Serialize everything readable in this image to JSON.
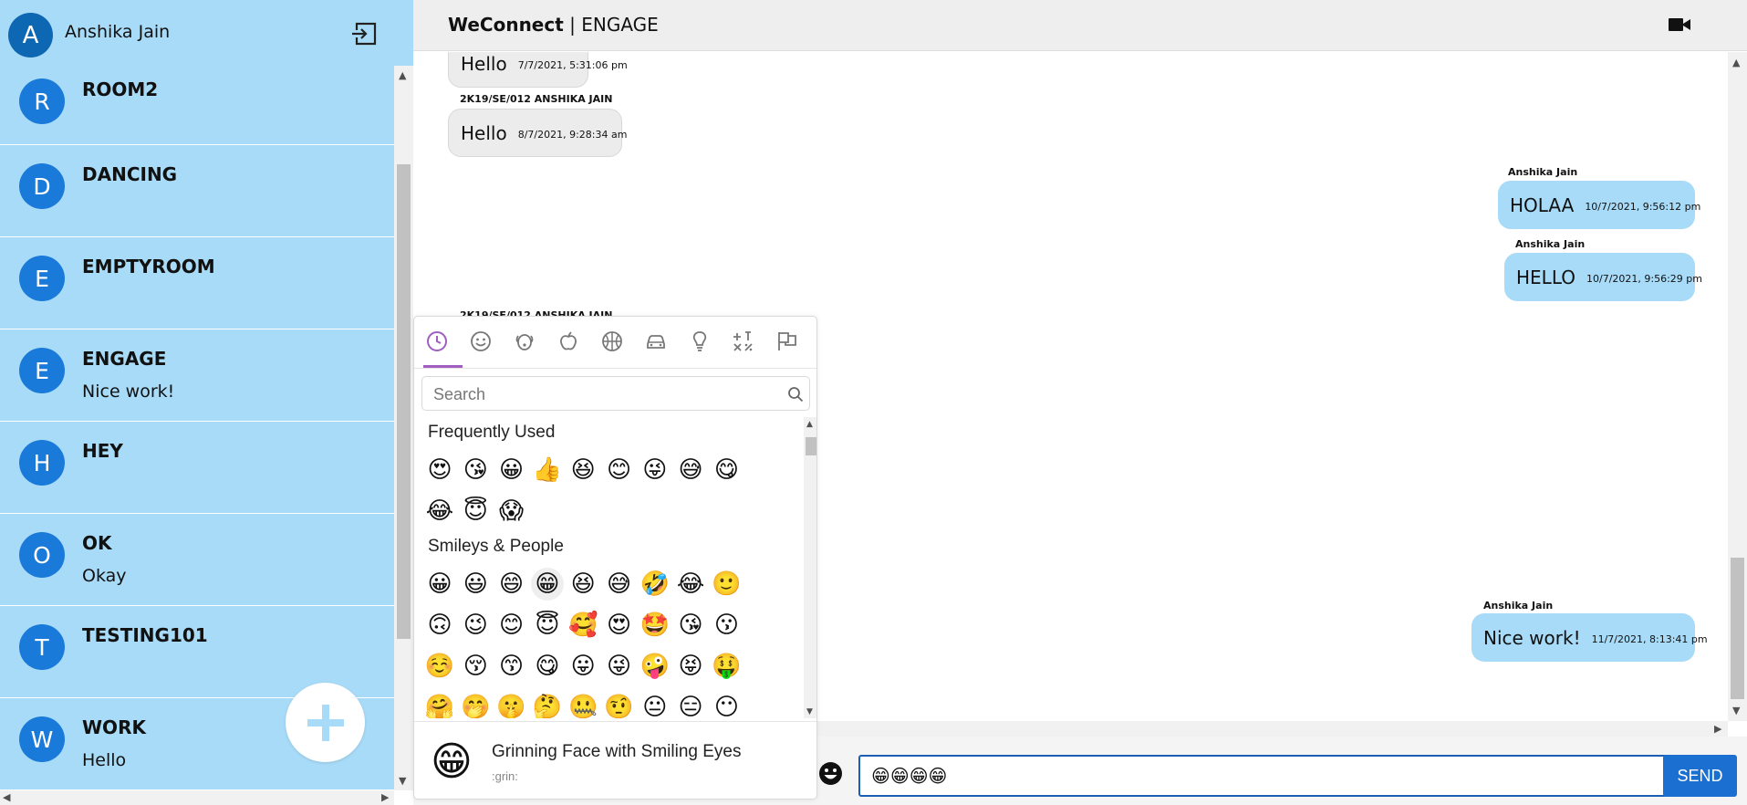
{
  "user": {
    "initial": "A",
    "name": "Anshika Jain"
  },
  "rooms": [
    {
      "initial": "R",
      "name": "ROOM2",
      "last": ""
    },
    {
      "initial": "D",
      "name": "DANCING",
      "last": ""
    },
    {
      "initial": "E",
      "name": "EMPTYROOM",
      "last": ""
    },
    {
      "initial": "E",
      "name": "ENGAGE",
      "last": "Nice work!"
    },
    {
      "initial": "H",
      "name": "HEY",
      "last": ""
    },
    {
      "initial": "O",
      "name": "OK",
      "last": "Okay"
    },
    {
      "initial": "T",
      "name": "TESTING101",
      "last": ""
    },
    {
      "initial": "W",
      "name": "WORK",
      "last": "Hello"
    }
  ],
  "header": {
    "brand": "WeConnect",
    "separator": " | ",
    "room": "ENGAGE"
  },
  "messages": [
    {
      "sender": "",
      "text": "Hello",
      "time": "7/7/2021, 5:31:06 pm",
      "own": false
    },
    {
      "sender": "2K19/SE/012 ANSHIKA JAIN",
      "text": "Hello",
      "time": "8/7/2021, 9:28:34 am",
      "own": false
    },
    {
      "sender": "Anshika Jain",
      "text": "HOLAA",
      "time": "10/7/2021, 9:56:12 pm",
      "own": true
    },
    {
      "sender": "Anshika Jain",
      "text": "HELLO",
      "time": "10/7/2021, 9:56:29 pm",
      "own": true
    },
    {
      "sender": "2K19/SE/012 ANSHIKA JAIN",
      "text": "",
      "time": "",
      "own": false
    },
    {
      "sender": "Anshika Jain",
      "text": "Nice work!",
      "time": "11/7/2021, 8:13:41 pm",
      "own": true
    }
  ],
  "composer": {
    "value": "😁😁😁😁",
    "send_label": "SEND"
  },
  "picker": {
    "search_placeholder": "Search",
    "categories": [
      "recent-icon",
      "smileys-icon",
      "animals-icon",
      "food-icon",
      "activity-icon",
      "travel-icon",
      "objects-icon",
      "symbols-icon",
      "flags-icon"
    ],
    "sections": [
      {
        "title": "Frequently Used",
        "emojis": [
          "😍",
          "😘",
          "😀",
          "👍",
          "😆",
          "😊",
          "😜",
          "😅",
          "😋",
          "😂",
          "😇",
          "😱"
        ]
      },
      {
        "title": "Smileys & People",
        "emojis": [
          "😀",
          "😃",
          "😄",
          "😁",
          "😆",
          "😅",
          "🤣",
          "😂",
          "🙂",
          "🙃",
          "😉",
          "😊",
          "😇",
          "🥰",
          "😍",
          "🤩",
          "😘",
          "😗",
          "☺️",
          "😚",
          "😙",
          "😋",
          "😛",
          "😜",
          "🤪",
          "😝",
          "🤑",
          "🤗",
          "🤭",
          "🤫",
          "🤔",
          "🤐",
          "🤨",
          "😐",
          "😑",
          "😶"
        ]
      }
    ],
    "preview": {
      "emoji": "😁",
      "name": "Grinning Face with Smiling Eyes",
      "short": ":grin:"
    }
  },
  "colors": {
    "sidebar": "#a8dbf7",
    "avatar": "#1a7ad9",
    "accent": "#1a6fd0",
    "picker_accent": "#a05fc0"
  }
}
